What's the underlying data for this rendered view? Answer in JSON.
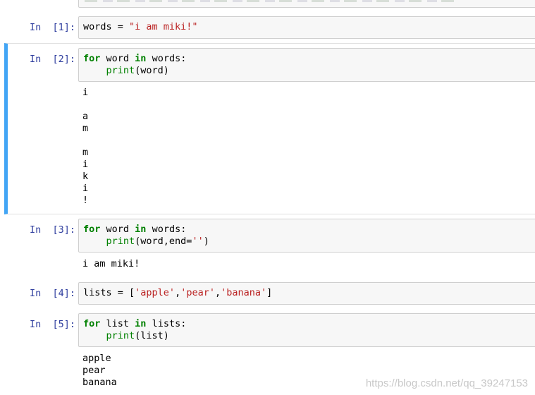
{
  "cells": [
    {
      "prompt": "In  [1]:",
      "code": [
        [
          {
            "t": "words = ",
            "c": "plain"
          },
          {
            "t": "\"i am miki!\"",
            "c": "str"
          }
        ]
      ],
      "output": ""
    },
    {
      "prompt": "In  [2]:",
      "code": [
        [
          {
            "t": "for",
            "c": "kw"
          },
          {
            "t": " word ",
            "c": "plain"
          },
          {
            "t": "in",
            "c": "kw"
          },
          {
            "t": " words:",
            "c": "plain"
          }
        ],
        [
          {
            "t": "    ",
            "c": "plain"
          },
          {
            "t": "print",
            "c": "bi"
          },
          {
            "t": "(word)",
            "c": "plain"
          }
        ]
      ],
      "output": "i\n\na\nm\n\nm\ni\nk\ni\n!"
    },
    {
      "prompt": "In  [3]:",
      "code": [
        [
          {
            "t": "for",
            "c": "kw"
          },
          {
            "t": " word ",
            "c": "plain"
          },
          {
            "t": "in",
            "c": "kw"
          },
          {
            "t": " words:",
            "c": "plain"
          }
        ],
        [
          {
            "t": "    ",
            "c": "plain"
          },
          {
            "t": "print",
            "c": "bi"
          },
          {
            "t": "(word,end=",
            "c": "plain"
          },
          {
            "t": "''",
            "c": "str"
          },
          {
            "t": ")",
            "c": "plain"
          }
        ]
      ],
      "output": "i am miki!"
    },
    {
      "prompt": "In  [4]:",
      "code": [
        [
          {
            "t": "lists = [",
            "c": "plain"
          },
          {
            "t": "'apple'",
            "c": "str"
          },
          {
            "t": ",",
            "c": "plain"
          },
          {
            "t": "'pear'",
            "c": "str"
          },
          {
            "t": ",",
            "c": "plain"
          },
          {
            "t": "'banana'",
            "c": "str"
          },
          {
            "t": "]",
            "c": "plain"
          }
        ]
      ],
      "output": ""
    },
    {
      "prompt": "In  [5]:",
      "code": [
        [
          {
            "t": "for",
            "c": "kw"
          },
          {
            "t": " list ",
            "c": "plain"
          },
          {
            "t": "in",
            "c": "kw"
          },
          {
            "t": " lists:",
            "c": "plain"
          }
        ],
        [
          {
            "t": "    ",
            "c": "plain"
          },
          {
            "t": "print",
            "c": "bi"
          },
          {
            "t": "(list)",
            "c": "plain"
          }
        ]
      ],
      "output": "apple\npear\nbanana"
    }
  ],
  "watermark": "https://blog.csdn.net/qq_39247153",
  "colors": {
    "keyword": "#008000",
    "string": "#ba2121",
    "prompt": "#303f9f",
    "selected_bar": "#42a5f5"
  }
}
